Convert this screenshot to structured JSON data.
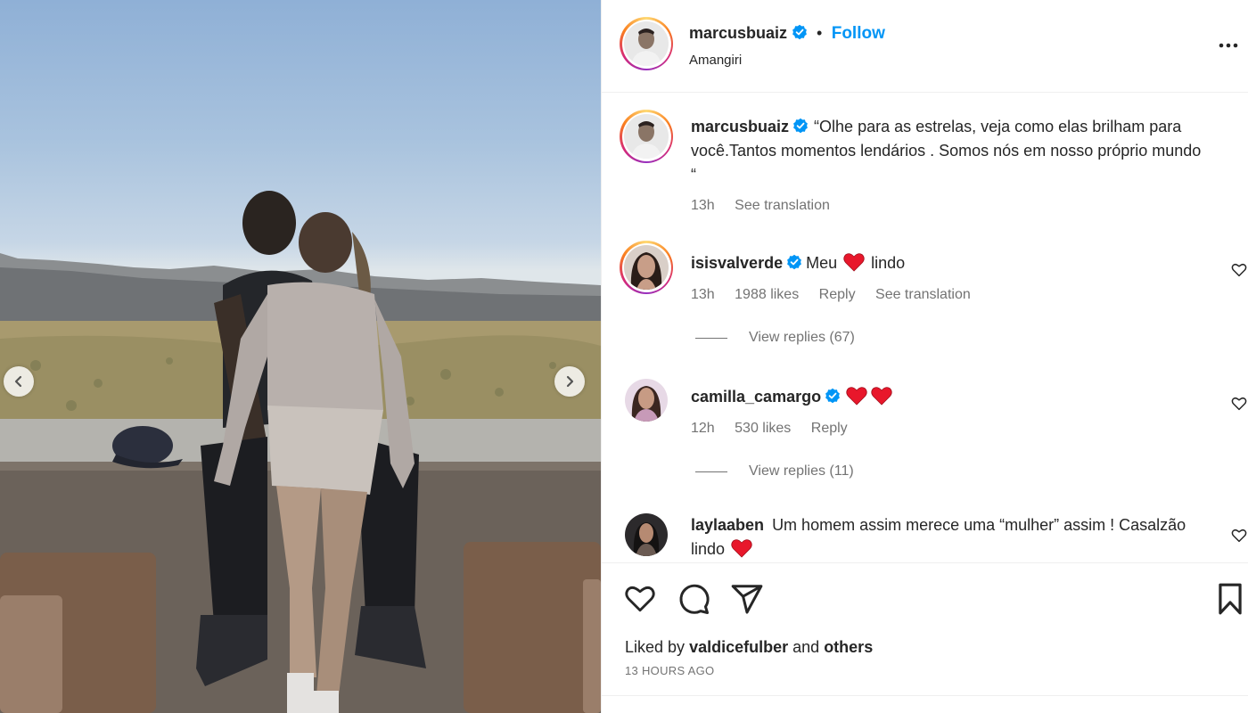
{
  "post": {
    "author": "marcusbuaiz",
    "follow_label": "Follow",
    "separator": "•",
    "location": "Amangiri"
  },
  "caption": {
    "username": "marcusbuaiz",
    "text": "“Olhe para as estrelas, veja como elas brilham para você.Tantos momentos lendários . Somos nós em nosso próprio mundo “",
    "time": "13h",
    "see_translation": "See translation"
  },
  "comments": [
    {
      "username": "isisvalverde",
      "text_before": "Meu",
      "text_after": "lindo",
      "time": "13h",
      "likes": "1988 likes",
      "reply": "Reply",
      "see_translation": "See translation",
      "view_replies": "View replies (67)"
    },
    {
      "username": "camilla_camargo",
      "time": "12h",
      "likes": "530 likes",
      "reply": "Reply",
      "view_replies": "View replies (11)"
    },
    {
      "username": "laylaaben",
      "text": "Um homem assim merece uma “mulher” assim ! Casalzão lindo"
    }
  ],
  "footer": {
    "liked_prefix": "Liked by",
    "liked_user": "valdicefulber",
    "liked_and": "and",
    "liked_others": "others",
    "timestamp": "13 HOURS AGO"
  },
  "icons": {
    "like": "heart-outline-icon",
    "comment": "speech-bubble-icon",
    "share": "paper-plane-icon",
    "save": "bookmark-icon",
    "more": "ellipsis-icon",
    "verified": "verified-badge-icon"
  },
  "colors": {
    "link_blue": "#0095f6",
    "verified_blue": "#0095f6",
    "heart_red": "#e8172b",
    "secondary_text": "#737373"
  }
}
